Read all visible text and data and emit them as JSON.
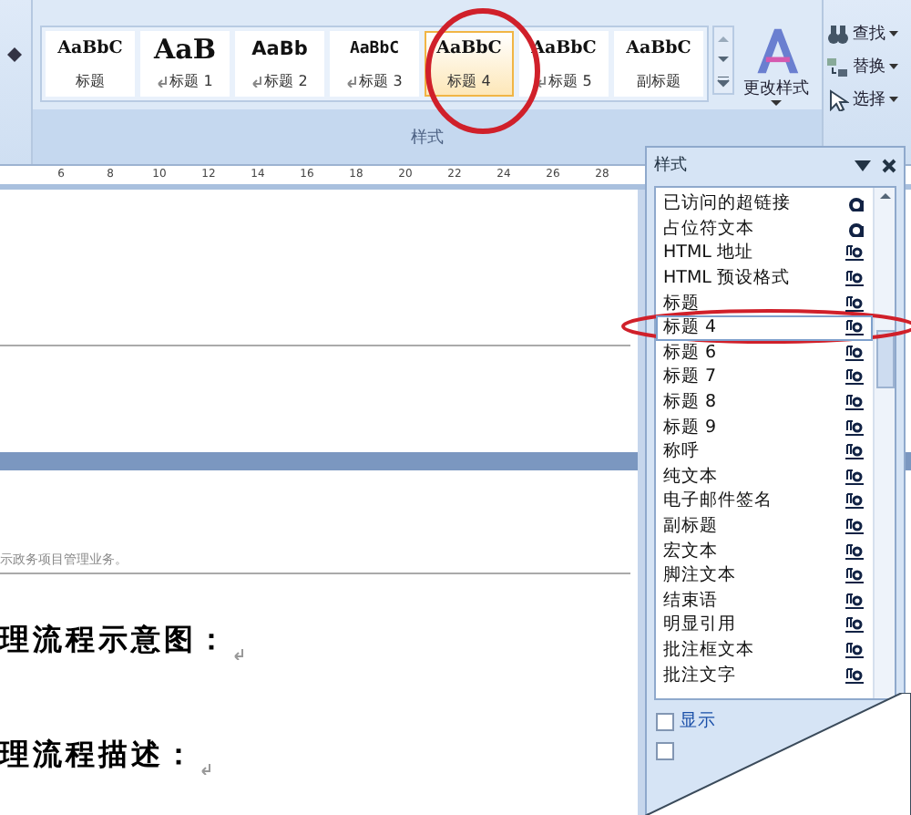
{
  "ribbon": {
    "gallery": [
      {
        "preview": "AaBbC",
        "label": "标题",
        "kind": "serif",
        "linked": false,
        "selected": false
      },
      {
        "preview": "AaB",
        "label": "标题 1",
        "kind": "big",
        "linked": true,
        "selected": false
      },
      {
        "preview": "AaBb",
        "label": "标题 2",
        "kind": "sans",
        "linked": true,
        "selected": false
      },
      {
        "preview": "AaBbC",
        "label": "标题 3",
        "kind": "mono",
        "linked": true,
        "selected": false
      },
      {
        "preview": "AaBbC",
        "label": "标题 4",
        "kind": "serif",
        "linked": false,
        "selected": true
      },
      {
        "preview": "AaBbC",
        "label": "标题 5",
        "kind": "serif",
        "linked": true,
        "selected": false
      },
      {
        "preview": "AaBbC",
        "label": "副标题",
        "kind": "serif",
        "linked": false,
        "selected": false
      }
    ],
    "change_styles": "更改样式",
    "group_label": "样式",
    "editing": [
      {
        "label": "查找",
        "kind": "find"
      },
      {
        "label": "替换",
        "kind": "replace"
      },
      {
        "label": "选择",
        "kind": "select"
      }
    ]
  },
  "ruler": [
    "6",
    "8",
    "10",
    "12",
    "14",
    "16",
    "18",
    "20",
    "22",
    "24",
    "26",
    "28"
  ],
  "document": {
    "note": "示政务项目管理业务。",
    "headings": [
      "理流程示意图：",
      "理流程描述："
    ]
  },
  "styles_pane": {
    "title": "样式",
    "items": [
      {
        "name": "已访问的超链接",
        "kind": "character",
        "selected": false
      },
      {
        "name": "占位符文本",
        "kind": "character",
        "selected": false
      },
      {
        "name": "HTML 地址",
        "kind": "linked",
        "selected": false
      },
      {
        "name": "HTML 预设格式",
        "kind": "linked",
        "selected": false
      },
      {
        "name": "标题",
        "kind": "linked",
        "selected": false
      },
      {
        "name": "标题 4",
        "kind": "linked",
        "selected": true
      },
      {
        "name": "标题 6",
        "kind": "linked",
        "selected": false
      },
      {
        "name": "标题 7",
        "kind": "linked",
        "selected": false
      },
      {
        "name": "标题 8",
        "kind": "linked",
        "selected": false
      },
      {
        "name": "标题 9",
        "kind": "linked",
        "selected": false
      },
      {
        "name": "称呼",
        "kind": "linked",
        "selected": false
      },
      {
        "name": "纯文本",
        "kind": "linked",
        "selected": false
      },
      {
        "name": "电子邮件签名",
        "kind": "linked",
        "selected": false
      },
      {
        "name": "副标题",
        "kind": "linked",
        "selected": false
      },
      {
        "name": "宏文本",
        "kind": "linked",
        "selected": false
      },
      {
        "name": "脚注文本",
        "kind": "linked",
        "selected": false
      },
      {
        "name": "结束语",
        "kind": "linked",
        "selected": false
      },
      {
        "name": "明显引用",
        "kind": "linked",
        "selected": false
      },
      {
        "name": "批注框文本",
        "kind": "linked",
        "selected": false
      },
      {
        "name": "批注文字",
        "kind": "linked",
        "selected": false
      }
    ],
    "options": [
      {
        "label": "显示",
        "checked": false
      },
      {
        "checked": false
      }
    ]
  }
}
